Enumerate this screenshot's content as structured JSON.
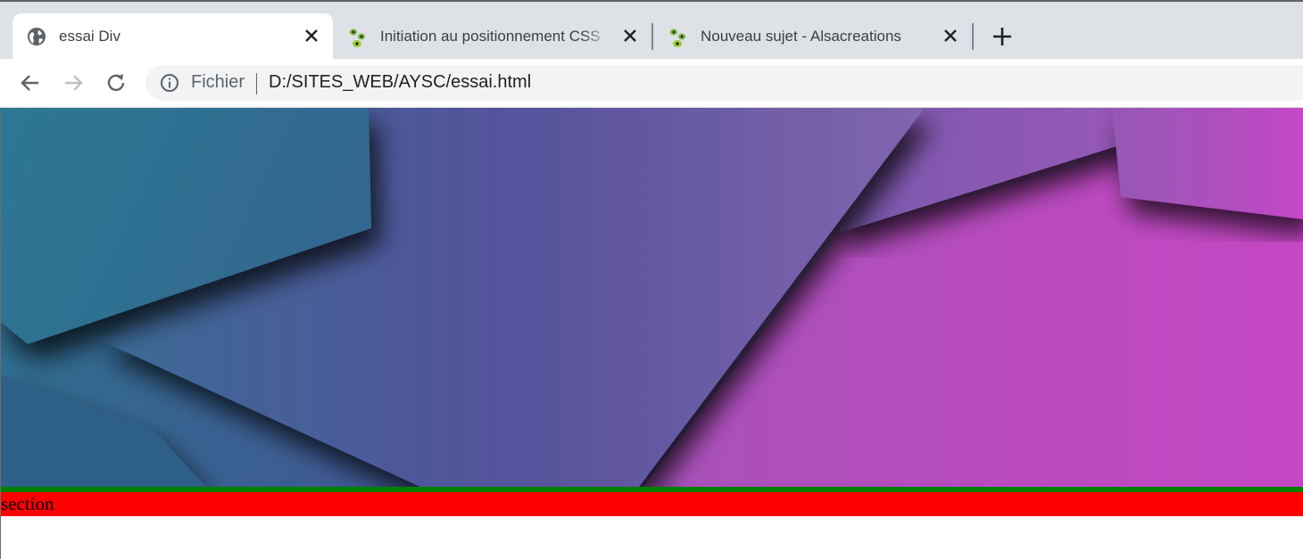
{
  "browser": {
    "tabs": [
      {
        "title": "essai Div",
        "active": true,
        "favicon": "globe-icon"
      },
      {
        "title": "Initiation au positionnement CSS",
        "active": false,
        "favicon": "alsacreations-icon"
      },
      {
        "title": "Nouveau sujet - Alsacreations",
        "active": false,
        "favicon": "alsacreations-icon"
      }
    ],
    "address_bar": {
      "scheme_label": "Fichier",
      "url": "D:/SITES_WEB/AYSC/essai.html"
    }
  },
  "page": {
    "section_text": "section",
    "colors": {
      "green_bar": "#008000",
      "section_bg": "#ff0000"
    }
  }
}
